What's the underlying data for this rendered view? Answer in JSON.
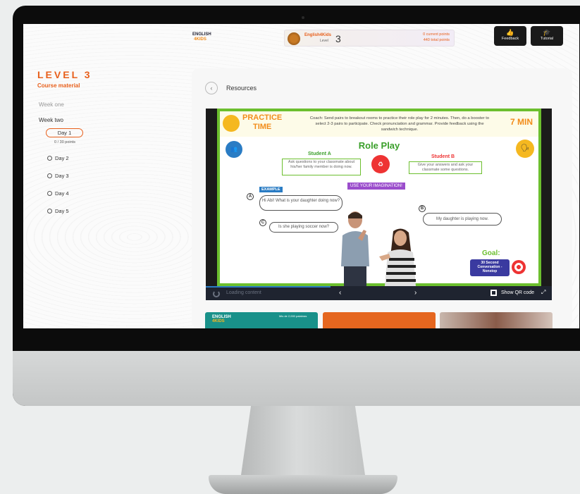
{
  "topbar": {
    "logo_line1": "ENGLISH",
    "logo_line2": "4KIDS",
    "brand_name": "English4Kids",
    "level_label": "Level",
    "level_number": "3",
    "current_points": "0 current points",
    "total_points": "440 total points",
    "feedback_label": "Feedback",
    "tutorial_label": "Tutorial"
  },
  "sidebar": {
    "level_title": "LEVEL 3",
    "course_material": "Course material",
    "week_one": "Week one",
    "week_two": "Week two",
    "active_day": "Day 1",
    "active_day_points": "0 / 30 points",
    "days": [
      "Day 2",
      "Day 3",
      "Day 4",
      "Day 5"
    ]
  },
  "main": {
    "resources_title": "Resources"
  },
  "slide": {
    "practice_line1": "PRACTICE",
    "practice_line2": "TIME",
    "coach_text": "Coach: Send pairs to breakout rooms to practice their role play for 2 minutes. Then, do a booster to select 2-3 pairs to participate. Check pronunciation and grammar. Provide feedback using the sandwich technique.",
    "minutes": "7 MIN",
    "title": "Role Play",
    "student_a": "Student A",
    "student_a_task": "Ask questions to your classmate about his/her family member is doing now.",
    "student_b": "Student B",
    "student_b_task": "Give your answers and ask your classmate some questions.",
    "example_tag": "EXAMPLE",
    "imagination_tag": "USE YOUR IMAGINATION!",
    "letter_a": "A",
    "letter_b": "B",
    "letter_c": "C",
    "bubble_a": "Hi Abi! What is your daughter doing now?",
    "bubble_b": "My daughter is playing now.",
    "bubble_c": "Is she playing soccer now?",
    "goal_label": "Goal:",
    "goal_text": "30 Second Conversation - Nonstop"
  },
  "controls": {
    "loading_text": "Loading content",
    "prev": "‹",
    "next": "›",
    "qr_label": "Show QR code",
    "expand": "⤢"
  },
  "thumbnails": {
    "t1_logo_line1": "ENGLISH",
    "t1_logo_line2": "4KIDS",
    "t1_text": "Mis de 2,000 palabras"
  },
  "colors": {
    "accent_orange": "#e8601c",
    "slide_green": "#6cbf2e",
    "dark_bar": "#1f2430"
  },
  "progress": 0.36
}
